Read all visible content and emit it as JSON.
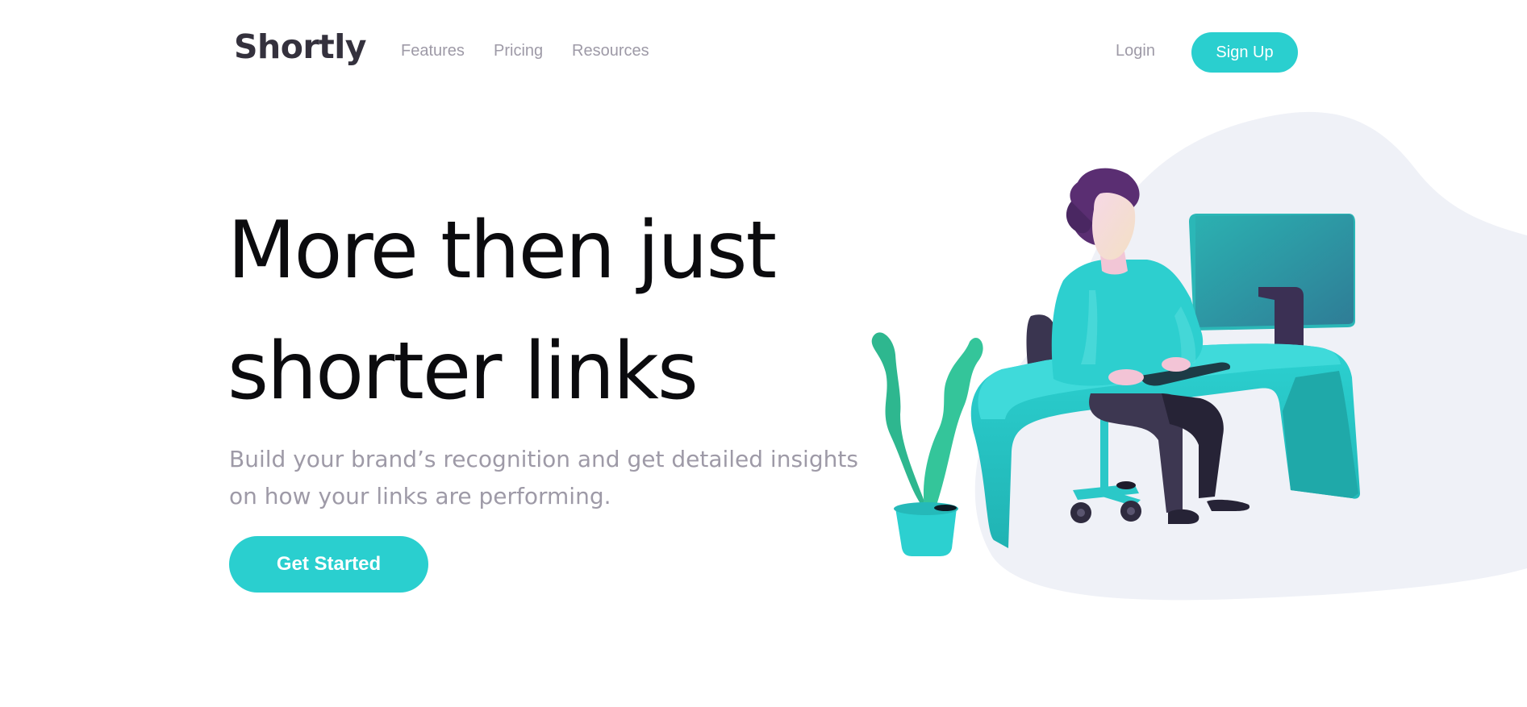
{
  "header": {
    "logo": "Shortly",
    "nav": [
      "Features",
      "Pricing",
      "Resources"
    ],
    "login": "Login",
    "signup": "Sign Up"
  },
  "hero": {
    "title_line1": "More then just",
    "title_line2": "shorter links",
    "subtitle": "Build your brand’s recognition and get detailed insights on how your links are performing.",
    "cta": "Get Started"
  },
  "illustration": {
    "icon": "person-working-at-desk-illustration"
  },
  "colors": {
    "primary": "#2acfcf",
    "dark": "#34313d",
    "gray": "#9e9aa7",
    "blob": "#eff1f7",
    "violet": "#3b3054"
  }
}
